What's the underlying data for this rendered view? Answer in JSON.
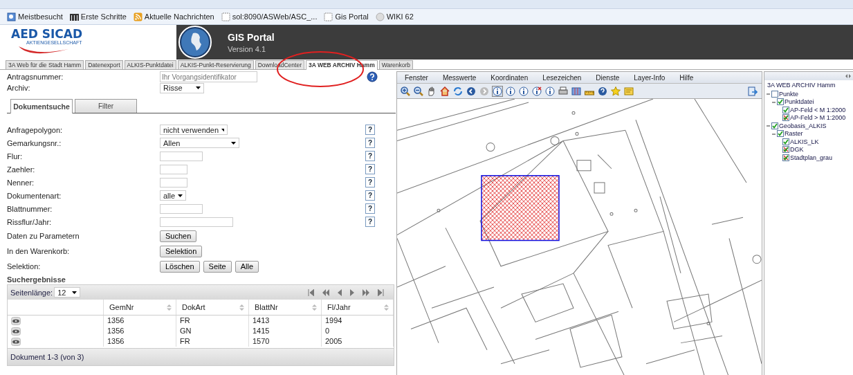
{
  "browser": {
    "bookmarks": [
      {
        "label": "Meistbesucht",
        "kind": "page"
      },
      {
        "label": "Erste Schritte",
        "kind": "brand"
      },
      {
        "label": "Aktuelle Nachrichten",
        "kind": "feed"
      },
      {
        "label": "sol:8090/ASWeb/ASC_...",
        "kind": "blank"
      },
      {
        "label": "Gis Portal",
        "kind": "blank"
      },
      {
        "label": "WIKI 62",
        "kind": "web"
      }
    ]
  },
  "header": {
    "company": "AED SICAD",
    "company_sub": "AKTIENGESELLSCHAFT",
    "title": "GIS Portal",
    "version": "Version 4.1"
  },
  "app_tabs": [
    {
      "label": "3A Web für die Stadt Hamm",
      "selected": false
    },
    {
      "label": "Datenexport",
      "selected": false
    },
    {
      "label": "ALKIS-Punktdatei",
      "selected": false
    },
    {
      "label": "ALKIS-Punkt-Reservierung",
      "selected": false
    },
    {
      "label": "DownloadCenter",
      "selected": false
    },
    {
      "label": "3A WEB ARCHIV Hamm",
      "selected": true
    },
    {
      "label": "Warenkorb",
      "selected": false
    }
  ],
  "form": {
    "request_number": {
      "label": "Antragsnummer:",
      "placeholder": "Ihr Vorgangsidentifikator"
    },
    "archive": {
      "label": "Archiv:",
      "value": "Risse"
    },
    "subtabs": [
      {
        "label": "Dokumentsuche",
        "selected": true
      },
      {
        "label": "Filter",
        "selected": false
      }
    ],
    "fields": [
      {
        "label": "Anfragepolygon:",
        "kind": "select",
        "value": "nicht verwenden",
        "help": "?"
      },
      {
        "label": "Gemarkungsnr.:",
        "kind": "select",
        "value": "Allen",
        "help": "?"
      },
      {
        "label": "Flur:",
        "kind": "input",
        "help": "?"
      },
      {
        "label": "Zaehler:",
        "kind": "input",
        "help": "?"
      },
      {
        "label": "Nenner:",
        "kind": "input",
        "help": "?"
      },
      {
        "label": "Dokumentenart:",
        "kind": "select",
        "value": "alle",
        "help": "?"
      },
      {
        "label": "Blattnummer:",
        "kind": "input",
        "help": "?"
      },
      {
        "label": "Rissflur/Jahr:",
        "kind": "input",
        "help": "?"
      }
    ],
    "actions": [
      {
        "label": "Daten zu Parametern",
        "buttons": [
          "Suchen"
        ]
      },
      {
        "label": "In den Warenkorb:",
        "buttons": [
          "Selektion"
        ]
      },
      {
        "label": "Selektion:",
        "buttons": [
          "Löschen",
          "Seite",
          "Alle"
        ]
      }
    ]
  },
  "results": {
    "title": "Suchergebnisse",
    "page_length_label": "Seitenlänge:",
    "page_length": "12",
    "columns": [
      "GemNr",
      "DokArt",
      "BlattNr",
      "Fl/Jahr"
    ],
    "rows": [
      {
        "cells": [
          "1356",
          "FR",
          "1413",
          "1994"
        ]
      },
      {
        "cells": [
          "1356",
          "GN",
          "1415",
          "0"
        ]
      },
      {
        "cells": [
          "1356",
          "FR",
          "1570",
          "2005"
        ]
      }
    ],
    "footer": "Dokument 1-3 (von 3)"
  },
  "map": {
    "menu": [
      "Fenster",
      "Messwerte",
      "Koordinaten",
      "Lesezeichen",
      "Dienste",
      "Layer-Info",
      "Hilfe"
    ],
    "tools": [
      {
        "selected": false
      },
      {
        "selected": false
      },
      {
        "selected": false
      },
      {
        "selected": false
      },
      {
        "selected": false
      },
      {
        "selected": false
      },
      {
        "selected": false
      },
      {
        "selected": true
      },
      {
        "selected": false
      },
      {
        "selected": false
      },
      {
        "selected": false
      },
      {
        "selected": false
      },
      {
        "selected": false
      },
      {
        "selected": false
      },
      {
        "selected": false
      },
      {
        "selected": false
      },
      {
        "selected": false
      },
      {
        "selected": false
      }
    ]
  },
  "layers": {
    "title": "3A WEB ARCHIV Hamm",
    "tree": [
      {
        "label": "Punkte",
        "checked": false,
        "inactive": false,
        "children": [
          {
            "label": "Punktdatei",
            "checked": true,
            "inactive": false,
            "children": [
              {
                "label": "AP-Feld < M 1:2000",
                "checked": true,
                "inactive": false
              },
              {
                "label": "AP-Feld > M 1:2000",
                "checked": true,
                "inactive": true
              }
            ]
          }
        ]
      },
      {
        "label": "Geobasis_ALKIS",
        "checked": true,
        "inactive": false,
        "children": [
          {
            "label": "Raster",
            "checked": true,
            "inactive": false,
            "children": [
              {
                "label": "ALKIS_LK",
                "checked": true,
                "inactive": false
              },
              {
                "label": "DGK",
                "checked": true,
                "inactive": true
              },
              {
                "label": "Stadtplan_grau",
                "checked": true,
                "inactive": true
              }
            ]
          }
        ]
      }
    ]
  }
}
